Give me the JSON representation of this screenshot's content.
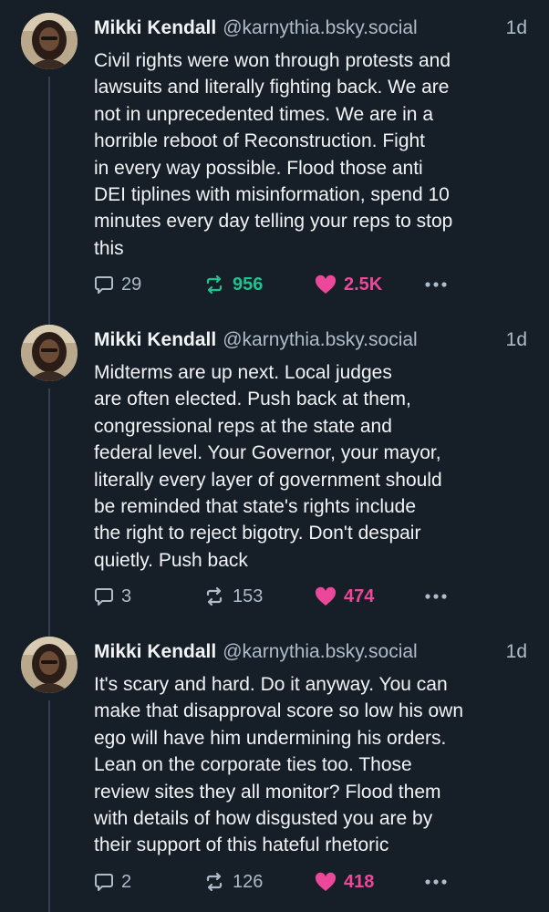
{
  "posts": [
    {
      "author": "Mikki Kendall",
      "handle": "@karnythia.bsky.social",
      "time": "1d",
      "text": "Civil rights were won through protests and\nlawsuits and literally fighting back. We are\nnot in unprecedented times. We are in a\nhorrible reboot of Reconstruction. Fight\nin every way possible. Flood those anti\nDEI tiplines with misinformation, spend 10\nminutes every day telling your reps to stop\nthis",
      "replies": "29",
      "reposts": "956",
      "likes": "2.5K",
      "reposted": true,
      "liked": true
    },
    {
      "author": "Mikki Kendall",
      "handle": "@karnythia.bsky.social",
      "time": "1d",
      "text": "Midterms are up next. Local judges\nare often elected. Push back at them,\ncongressional reps at the state and\nfederal level. Your Governor, your mayor,\nliterally every layer of government should\nbe reminded that state's rights include\nthe right to reject bigotry. Don't despair\nquietly. Push back",
      "replies": "3",
      "reposts": "153",
      "likes": "474",
      "reposted": false,
      "liked": true
    },
    {
      "author": "Mikki Kendall",
      "handle": "@karnythia.bsky.social",
      "time": "1d",
      "text": "It's scary and hard. Do it anyway. You can\nmake that disapproval score so low his own\nego will have him undermining his orders.\nLean on the corporate ties too. Those\nreview sites they all monitor? Flood them\nwith details of how disgusted you are by\ntheir support of this hateful rhetoric",
      "replies": "2",
      "reposts": "126",
      "likes": "418",
      "reposted": false,
      "liked": true
    }
  ],
  "colors": {
    "background": "#161e27",
    "muted": "#aebbc9",
    "repost_active": "#20c28f",
    "like_active": "#ec4899",
    "thread_line": "#2e4052"
  },
  "icons": {
    "reply": "speech-bubble-icon",
    "repost": "repost-arrows-icon",
    "like": "heart-icon",
    "more": "ellipsis-icon"
  }
}
